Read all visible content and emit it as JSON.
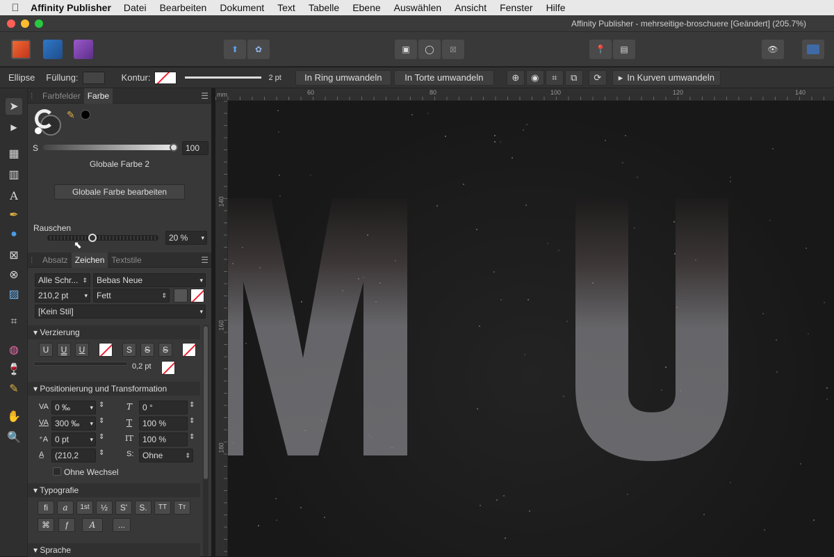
{
  "menubar": {
    "app": "Affinity Publisher",
    "items": [
      "Datei",
      "Bearbeiten",
      "Dokument",
      "Text",
      "Tabelle",
      "Ebene",
      "Auswählen",
      "Ansicht",
      "Fenster",
      "Hilfe"
    ]
  },
  "window": {
    "title": "Affinity Publisher - mehrseitige-broschuere [Geändert] (205.7%)"
  },
  "context_toolbar": {
    "tool_name": "Ellipse",
    "fill_label": "Füllung:",
    "stroke_label": "Kontur:",
    "stroke_width": "2 pt",
    "btn_ring": "In Ring umwandeln",
    "btn_pie": "In Torte umwandeln",
    "btn_curves": "In Kurven umwandeln"
  },
  "color_panel": {
    "tabs": [
      "Farbfelder",
      "Farbe"
    ],
    "s_label": "S",
    "s_value": "100",
    "s_fraction": 1.0,
    "global_color_name": "Globale Farbe 2",
    "edit_button": "Globale Farbe bearbeiten",
    "noise_label": "Rauschen",
    "noise_value": "20 %",
    "noise_fraction": 0.2
  },
  "char_panel": {
    "tabs": [
      "Absatz",
      "Zeichen",
      "Textstile"
    ],
    "font_collection": "Alle Schr...",
    "font_family": "Bebas Neue",
    "font_size": "210,2 pt",
    "font_weight": "Fett",
    "style": "[Kein Stil]"
  },
  "decoration": {
    "header": "Verzierung",
    "underline_btns": [
      "U",
      "U",
      "U"
    ],
    "strike_btns": [
      "S",
      "S",
      "S"
    ],
    "line_width": "0,2 pt"
  },
  "transform": {
    "header": "Positionierung und Transformation",
    "tracking": "0 ‰",
    "leading_or_kerning": "300 ‰",
    "baseline": "0 pt",
    "size_field": "(210,2",
    "shear": "0 °",
    "horizontal_scale": "100 %",
    "vertical_scale": "100 %",
    "shift_option": "Ohne",
    "no_break_label": "Ohne Wechsel"
  },
  "typography": {
    "header": "Typografie",
    "row1": [
      "fi",
      "a",
      "1st",
      "½",
      "S'",
      "S.",
      "TT",
      "Tт"
    ],
    "row2": [
      "⌘",
      "ƒ",
      "A",
      "..."
    ]
  },
  "language": {
    "header": "Sprache"
  },
  "rulers": {
    "unit": "mm",
    "top_ticks": [
      "60",
      "80",
      "100",
      "120",
      "140"
    ],
    "left_ticks": [
      "140",
      "160",
      "180"
    ]
  },
  "canvas": {
    "letters": [
      "M",
      "U"
    ]
  },
  "colors": {
    "accent": "#2b72d6",
    "canvas_bg": "#1b1b1b",
    "letter": "#6a6a6e",
    "panel_bg": "#383838"
  }
}
